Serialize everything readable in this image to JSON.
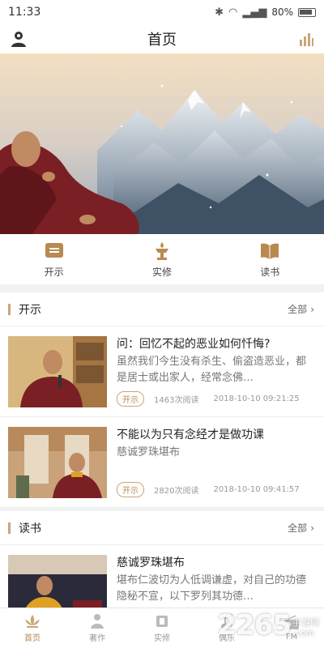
{
  "status_bar": {
    "time": "11:33",
    "battery": "80%"
  },
  "header": {
    "title": "首页"
  },
  "quick_nav": [
    {
      "label": "开示"
    },
    {
      "label": "实修"
    },
    {
      "label": "读书"
    }
  ],
  "sections": [
    {
      "title": "开示",
      "more": "全部",
      "articles": [
        {
          "title": "问：回忆不起的恶业如何忏悔?",
          "excerpt": "虽然我们今生没有杀生、偷盗造恶业，都是居士或出家人，经常念佛…",
          "tag": "开示",
          "views": "1463次阅读",
          "date": "2018-10-10 09:21:25"
        },
        {
          "title": "不能以为只有念经才是做功课",
          "excerpt": "慈诚罗珠堪布",
          "tag": "开示",
          "views": "2820次阅读",
          "date": "2018-10-10 09:41:57"
        }
      ]
    },
    {
      "title": "读书",
      "more": "全部",
      "articles": [
        {
          "title": "慈诚罗珠堪布",
          "excerpt": "堪布仁波切为人低调谦虚，对自己的功德隐秘不宣，以下罗列其功德…"
        }
      ]
    }
  ],
  "bottom_nav": [
    {
      "label": "首页",
      "active": true
    },
    {
      "label": "著作",
      "active": false
    },
    {
      "label": "实修",
      "active": false
    },
    {
      "label": "偶乐",
      "active": false
    },
    {
      "label": "FM",
      "active": false
    }
  ],
  "watermark": {
    "big": "2265",
    "small_top": "手游网",
    "small_bottom": ".com"
  },
  "colors": {
    "accent": "#c9a67a",
    "accent_text": "#b88a50",
    "robe": "#7a1f24"
  }
}
